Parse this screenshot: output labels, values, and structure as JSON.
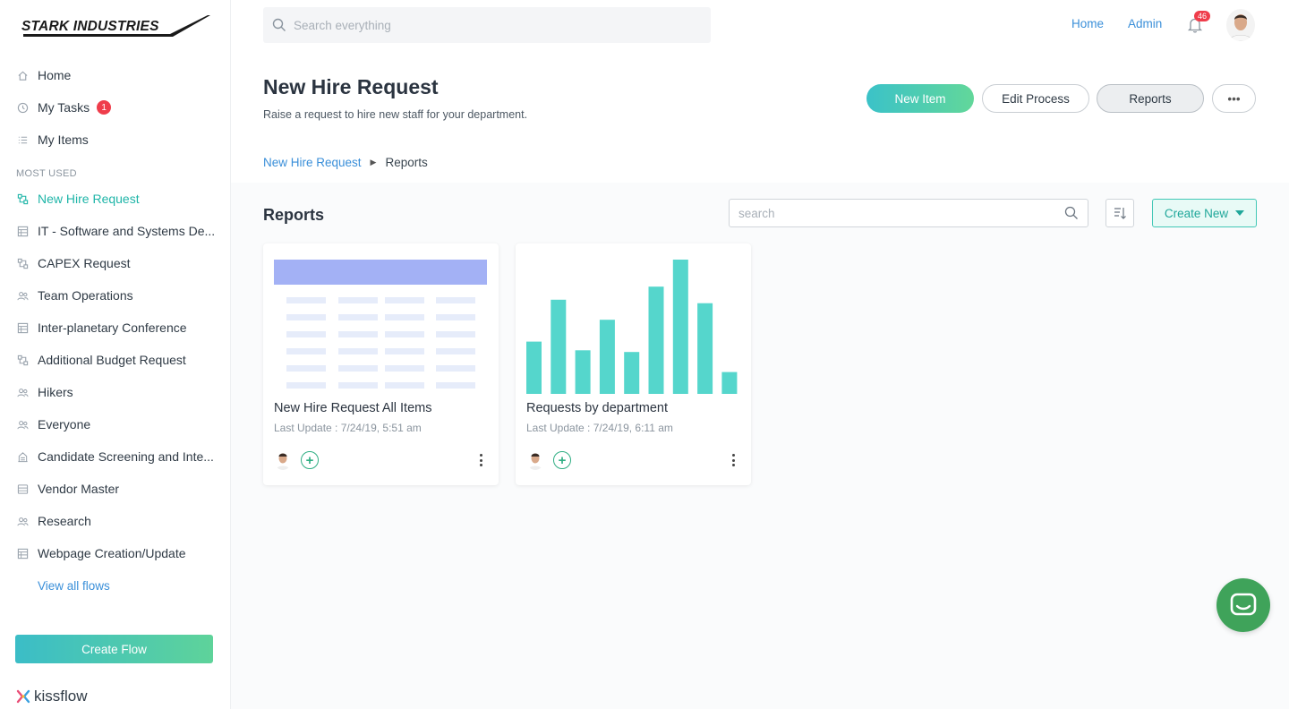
{
  "brand": {
    "logo_text": "STARK INDUSTRIES",
    "footer": "kissflow"
  },
  "topbar": {
    "search_placeholder": "Search everything",
    "links": {
      "home": "Home",
      "admin": "Admin"
    },
    "notification_count": "46"
  },
  "sidebar": {
    "primary": [
      {
        "label": "Home",
        "icon": "home-icon"
      },
      {
        "label": "My Tasks",
        "icon": "clock-icon",
        "badge": "1"
      },
      {
        "label": "My Items",
        "icon": "list-icon"
      }
    ],
    "section_label": "MOST USED",
    "flows": [
      {
        "label": "New Hire Request",
        "icon": "flow-icon",
        "active": true
      },
      {
        "label": "IT - Software and Systems De...",
        "icon": "table-icon"
      },
      {
        "label": "CAPEX Request",
        "icon": "flow-icon"
      },
      {
        "label": "Team Operations",
        "icon": "people-icon"
      },
      {
        "label": "Inter-planetary Conference",
        "icon": "table-icon"
      },
      {
        "label": "Additional Budget Request",
        "icon": "flow-icon"
      },
      {
        "label": "Hikers",
        "icon": "people-icon"
      },
      {
        "label": "Everyone",
        "icon": "people-icon"
      },
      {
        "label": "Candidate Screening and Inte...",
        "icon": "building-icon"
      },
      {
        "label": "Vendor Master",
        "icon": "database-icon"
      },
      {
        "label": "Research",
        "icon": "people-icon"
      },
      {
        "label": "Webpage Creation/Update",
        "icon": "table-icon"
      }
    ],
    "view_all": "View all flows",
    "create_flow": "Create Flow"
  },
  "header": {
    "title": "New Hire Request",
    "subtitle": "Raise a request to hire new staff for your department.",
    "buttons": {
      "new_item": "New Item",
      "edit_process": "Edit Process",
      "reports": "Reports",
      "more": "•••"
    },
    "breadcrumb": {
      "parent": "New Hire Request",
      "current": "Reports"
    }
  },
  "reports": {
    "title": "Reports",
    "search_placeholder": "search",
    "create_new": "Create New",
    "cards": [
      {
        "title": "New Hire Request All Items",
        "meta": "Last Update : 7/24/19, 5:51 am",
        "type": "table"
      },
      {
        "title": "Requests by department",
        "meta": "Last Update : 7/24/19, 6:11 am",
        "type": "bar",
        "bar_values": [
          6.0,
          10.8,
          5.0,
          8.5,
          4.8,
          12.3,
          15.4,
          10.4,
          2.5
        ]
      }
    ]
  },
  "colors": {
    "accent": "#1fb5a8",
    "link": "#3a8fd9",
    "badge": "#ef3d4b",
    "chart_bar": "#55d6cc",
    "table_header": "#a3b1f5",
    "chat": "#3fa35a"
  }
}
